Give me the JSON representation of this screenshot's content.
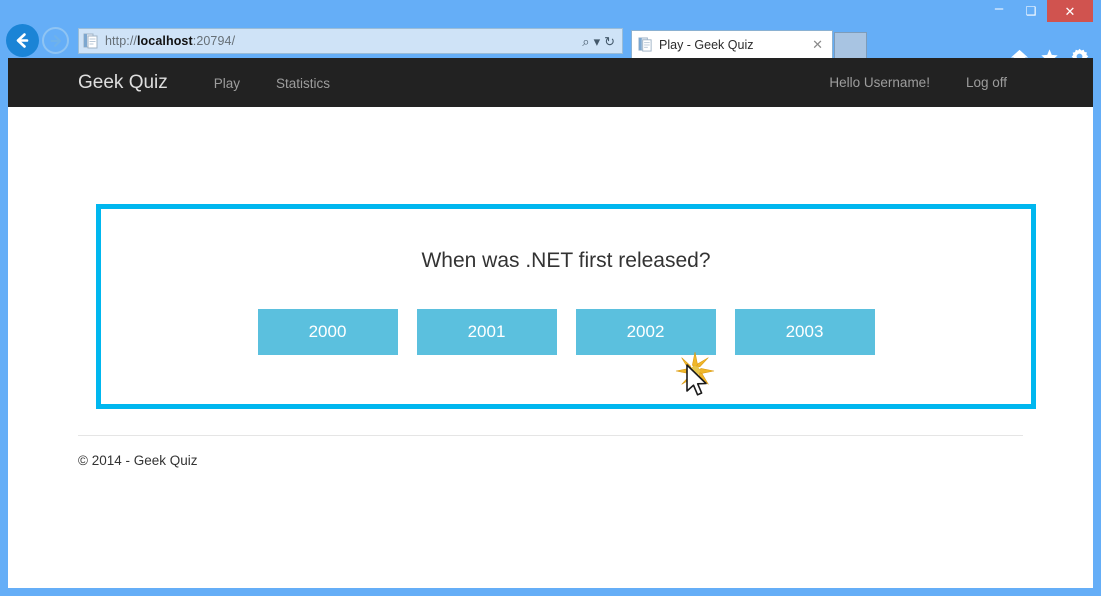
{
  "browser": {
    "window_controls": {
      "minimize": "–",
      "maximize": "❑",
      "close": "✕"
    },
    "back_button": "back-arrow",
    "forward_button": "forward-arrow",
    "address": {
      "scheme": "http://",
      "host": "localhost",
      "rest": ":20794/",
      "full_url": "http://localhost:20794/",
      "search_icon": "⌕",
      "dropdown_icon": "▾",
      "refresh_icon": "↻"
    },
    "tab": {
      "title": "Play - Geek Quiz",
      "close_label": "✕"
    },
    "tools": {
      "home": "home-icon",
      "favorites": "star-icon",
      "settings": "gear-icon"
    }
  },
  "site": {
    "brand": "Geek Quiz",
    "nav_links": [
      {
        "label": "Play"
      },
      {
        "label": "Statistics"
      }
    ],
    "user_links": [
      {
        "label": "Hello Username!"
      },
      {
        "label": "Log off"
      }
    ]
  },
  "quiz": {
    "question": "When was .NET first released?",
    "answers": [
      {
        "label": "2000"
      },
      {
        "label": "2001"
      },
      {
        "label": "2002"
      },
      {
        "label": "2003"
      }
    ],
    "clicked_answer": "2002"
  },
  "footer": {
    "copyright": "© 2014 - Geek Quiz"
  },
  "colors": {
    "window_frame": "#65aef7",
    "navbar_bg": "#222222",
    "card_border": "#00b7ef",
    "answer_button": "#5bc0de",
    "close_button": "#d0534f",
    "click_burst": "#f0b323"
  }
}
